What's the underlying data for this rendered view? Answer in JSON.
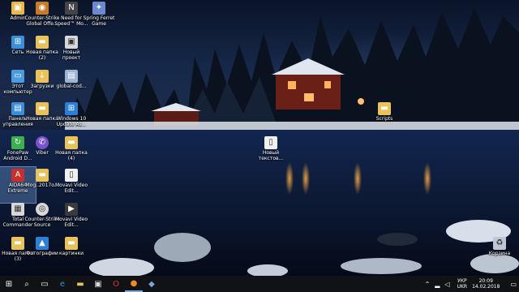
{
  "desktop_icons": [
    {
      "label": "Admin",
      "icon": "user-folder-icon",
      "color": "#e9b84a"
    },
    {
      "label": "Counter-Strike Global Offe...",
      "icon": "cs-go-icon",
      "color": "#c77b2a"
    },
    {
      "label": "Need for Speed™ Mo...",
      "icon": "nfs-icon",
      "color": "#444444"
    },
    {
      "label": "Spring Ferret Game",
      "icon": "game-icon",
      "color": "#6a8bd0"
    },
    {
      "label": "Сеть",
      "icon": "network-icon",
      "color": "#3a8fd8"
    },
    {
      "label": "Новая папка (2)",
      "icon": "folder-icon",
      "color": "#e9c25a"
    },
    {
      "label": "Новый проект",
      "icon": "project-icon",
      "color": "#d8d8d8"
    },
    {
      "label": "Этот компьютер",
      "icon": "computer-icon",
      "color": "#4a9be0"
    },
    {
      "label": "Загрузки",
      "icon": "downloads-folder-icon",
      "color": "#e9c25a"
    },
    {
      "label": "global-cod...",
      "icon": "file-icon",
      "color": "#9fb4d0"
    },
    {
      "label": "Панель управления",
      "icon": "control-panel-icon",
      "color": "#3a8fd8"
    },
    {
      "label": "Новая папка",
      "icon": "folder-icon",
      "color": "#e9c25a"
    },
    {
      "label": "Windows 10 Update As...",
      "icon": "windows-update-icon",
      "color": "#2b7fd6"
    },
    {
      "label": "FonePaw Android D...",
      "icon": "fonepaw-icon",
      "color": "#3cb04a"
    },
    {
      "label": "Viber",
      "icon": "viber-icon",
      "color": "#7b52c9"
    },
    {
      "label": "Новая папка (4)",
      "icon": "folder-icon",
      "color": "#e9c25a"
    },
    {
      "label": "AIDA64 Extreme",
      "icon": "aida64-icon",
      "color": "#c9302c"
    },
    {
      "label": "Mog..2017o...",
      "icon": "folder-icon",
      "color": "#e9c25a"
    },
    {
      "label": "Movavi Video Edit...",
      "icon": "document-icon",
      "color": "#f0f0f0"
    },
    {
      "label": "Total Commander",
      "icon": "total-commander-icon",
      "color": "#d8d8d8"
    },
    {
      "label": "Counter-Strike Source",
      "icon": "cs-source-icon",
      "color": "#d8d8d8"
    },
    {
      "label": "Movavi Video Edit...",
      "icon": "movavi-icon",
      "color": "#3a3a3a"
    },
    {
      "label": "Новая папка (3)",
      "icon": "folder-icon",
      "color": "#e9c25a"
    },
    {
      "label": "Фотографии",
      "icon": "photos-icon",
      "color": "#2b7fd6"
    },
    {
      "label": "картинки",
      "icon": "folder-icon",
      "color": "#e9c25a"
    },
    {
      "label": "Scripts",
      "icon": "scripts-folder-icon",
      "color": "#e9c25a"
    },
    {
      "label": "Новый текстов...",
      "icon": "text-file-icon",
      "color": "#f0f0f0"
    },
    {
      "label": "Корзина",
      "icon": "recycle-bin-icon",
      "color": "#bfc7d4"
    }
  ],
  "taskbar": {
    "start_icon": "windows-logo-icon",
    "search_icon": "search-icon",
    "task_view_icon": "task-view-icon",
    "apps": [
      "edge-icon",
      "file-explorer-icon",
      "store-icon",
      "opera-icon",
      "firefox-icon",
      "app-icon"
    ],
    "tray": {
      "lang_top": "УКР",
      "lang_bottom": "UKR",
      "time": "20:09",
      "date": "14.02.2018"
    }
  }
}
